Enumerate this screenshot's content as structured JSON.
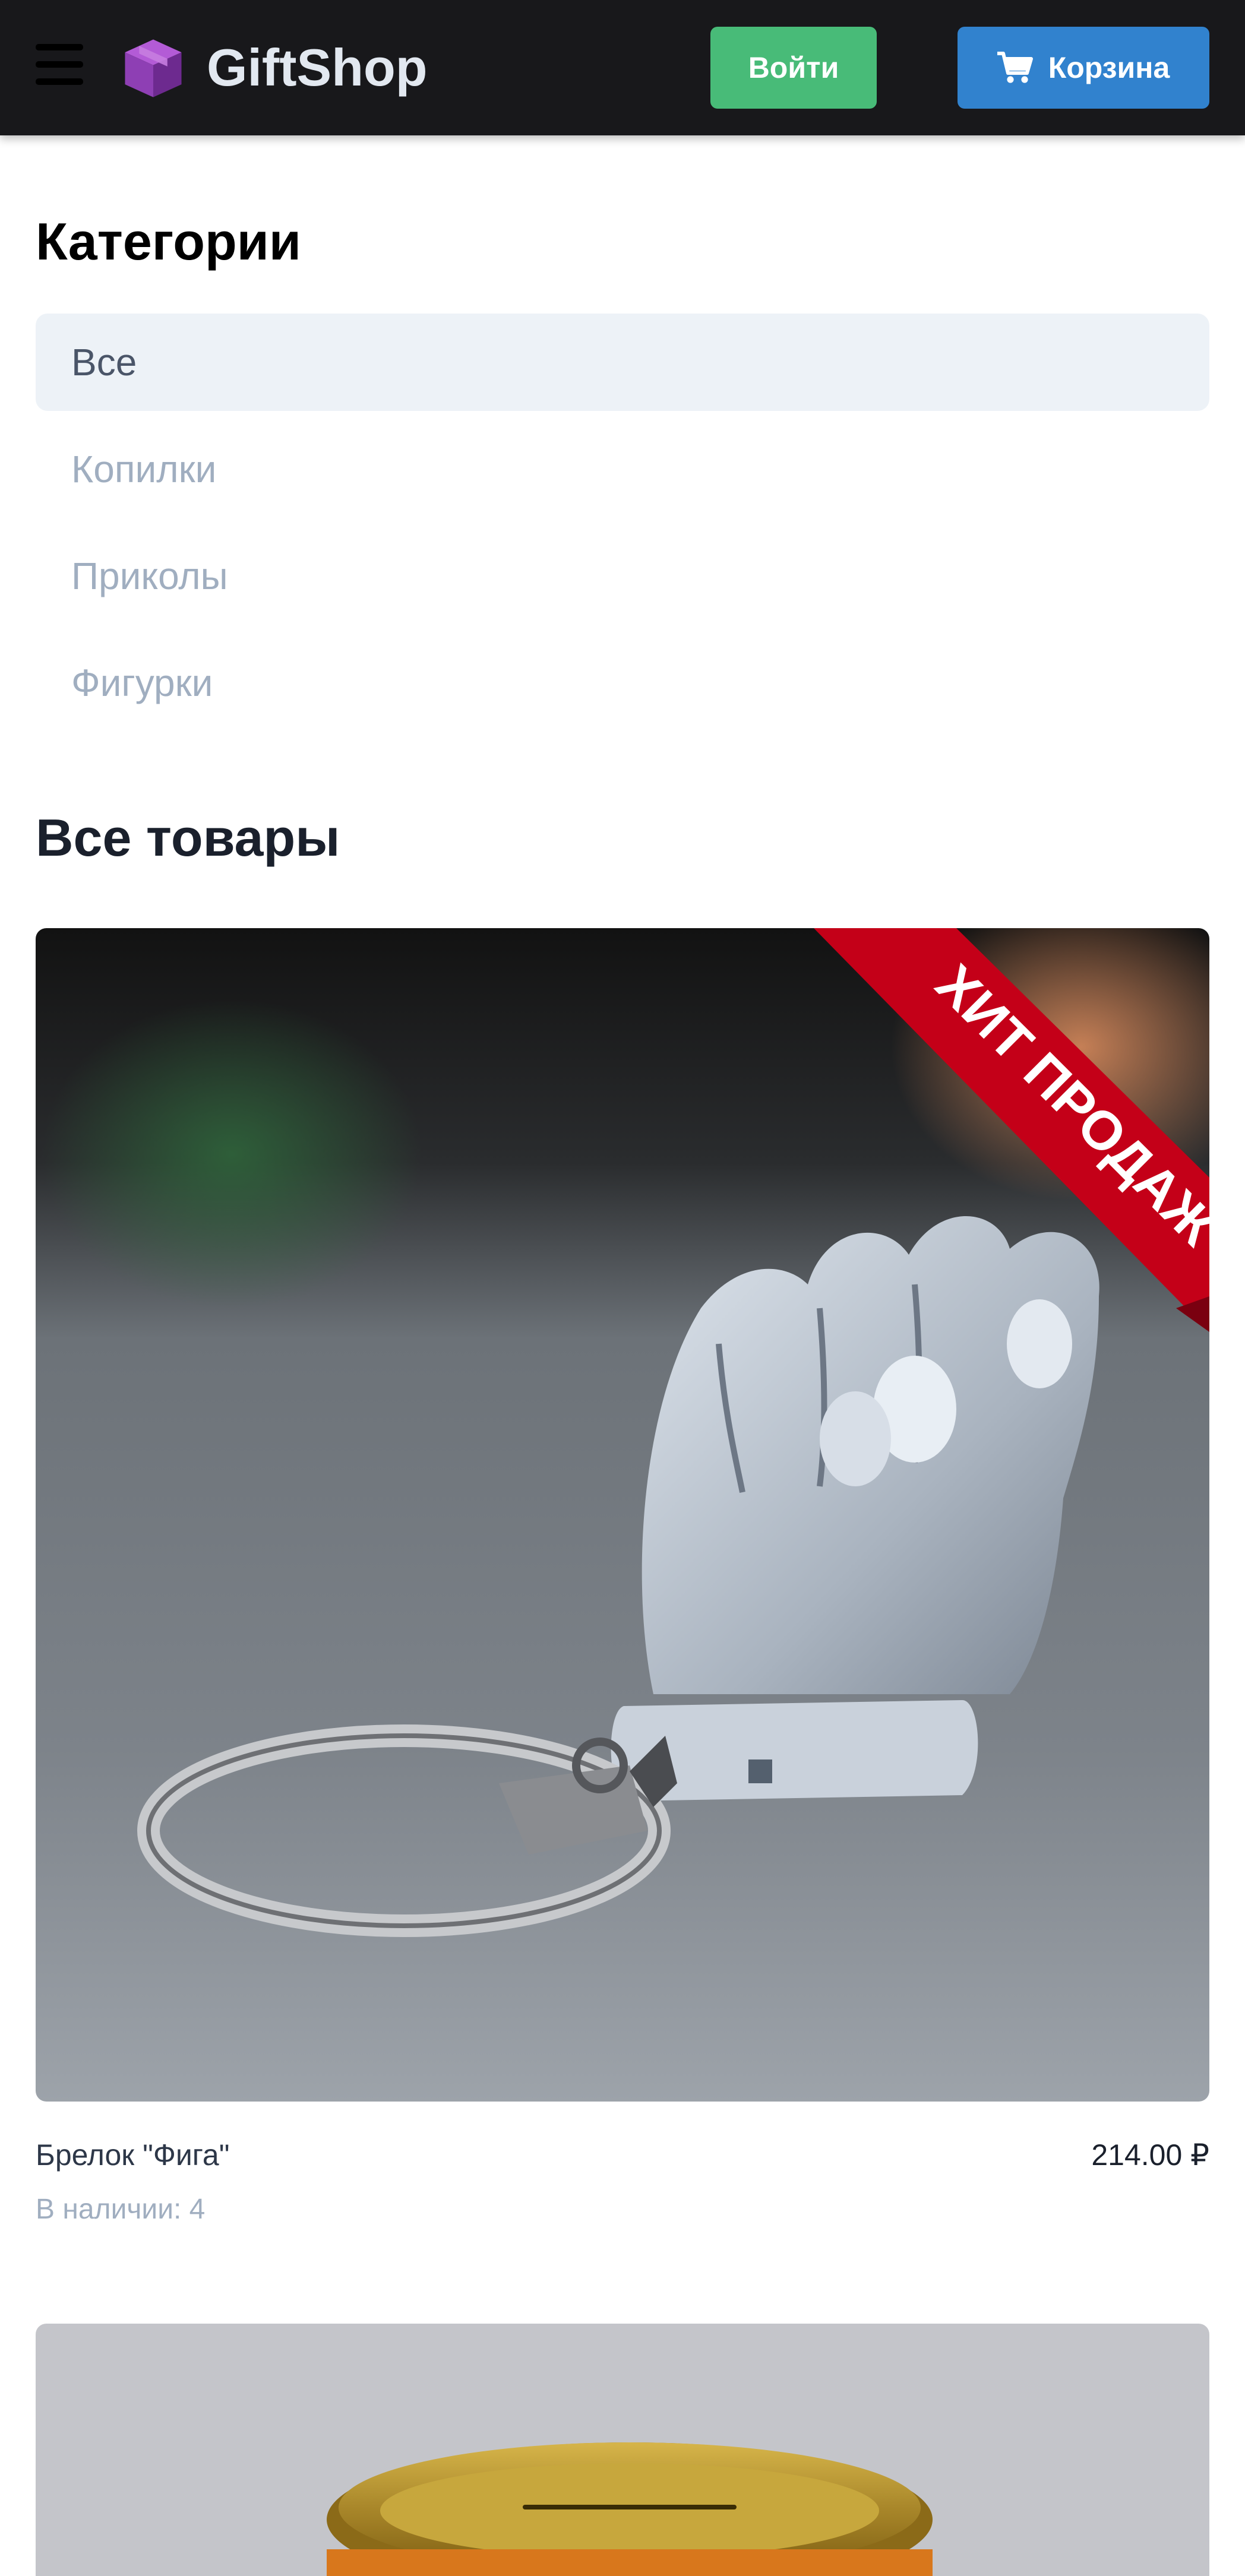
{
  "header": {
    "brand": "GiftShop",
    "login_label": "Войти",
    "cart_label": "Корзина"
  },
  "categories": {
    "title": "Категории",
    "items": [
      {
        "label": "Все",
        "active": true
      },
      {
        "label": "Копилки",
        "active": false
      },
      {
        "label": "Приколы",
        "active": false
      },
      {
        "label": "Фигурки",
        "active": false
      }
    ]
  },
  "products_section": {
    "title": "Все товары",
    "items": [
      {
        "name": "Брелок \"Фига\"",
        "price": "214.00 ₽",
        "stock": "В наличии: 4",
        "badge": "ХИТ ПРОДАЖ"
      }
    ]
  },
  "icons": {
    "menu": "hamburger-menu-icon",
    "logo": "cube-logo-icon",
    "cart": "shopping-cart-icon"
  },
  "colors": {
    "navbar": "#18181b",
    "login_button": "#48bb78",
    "cart_button": "#3182ce",
    "category_active_bg": "#edf2f7",
    "badge_ribbon": "#c40018"
  }
}
